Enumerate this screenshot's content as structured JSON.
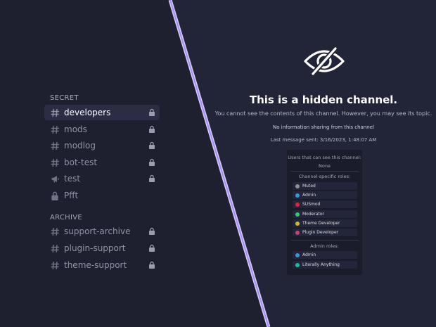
{
  "sidebar": {
    "categories": [
      {
        "name": "SECRET",
        "channels": [
          {
            "name": "developers",
            "icon": "text-channel-hash-icon",
            "locked": true,
            "selected": true
          },
          {
            "name": "mods",
            "icon": "text-channel-hash-icon",
            "locked": true
          },
          {
            "name": "modlog",
            "icon": "text-channel-hash-icon",
            "locked": true
          },
          {
            "name": "bot-test",
            "icon": "text-channel-hash-icon",
            "locked": true
          },
          {
            "name": "test",
            "icon": "announcement-megaphone-icon",
            "locked": true
          },
          {
            "name": "Pfft",
            "icon": "locked-voice-lock-icon",
            "locked": false
          }
        ]
      },
      {
        "name": "ARCHIVE",
        "channels": [
          {
            "name": "support-archive",
            "icon": "text-channel-hash-icon",
            "locked": true
          },
          {
            "name": "plugin-support",
            "icon": "text-channel-hash-icon",
            "locked": true
          },
          {
            "name": "theme-support",
            "icon": "text-channel-hash-icon",
            "locked": true
          }
        ]
      }
    ]
  },
  "hidden": {
    "icon": "eye-slash-icon",
    "title": "This is a hidden channel.",
    "subtitle": "You cannot see the contents of this channel. However, you may see its topic.",
    "topic": "No information sharing from this channel",
    "last_message": "Last message sent: 3/16/2023, 1:48:07 AM",
    "users_header": "Users that can see this channel:",
    "users_value": "None",
    "channel_roles_header": "Channel-specific roles:",
    "channel_roles": [
      {
        "name": "Muted",
        "color": "#8e9297"
      },
      {
        "name": "Admin",
        "color": "#3498db"
      },
      {
        "name": "SUSmod",
        "color": "#e91e3c"
      },
      {
        "name": "Moderator",
        "color": "#2ecc71"
      },
      {
        "name": "Theme Developer",
        "color": "#d4b62a"
      },
      {
        "name": "Plugin Developer",
        "color": "#c0447c"
      }
    ],
    "admin_roles_header": "Admin roles:",
    "admin_roles": [
      {
        "name": "Admin",
        "color": "#3498db"
      },
      {
        "name": "Literally Anything",
        "color": "#1abc9c"
      }
    ]
  },
  "colors": {
    "divider": "#b8a6ff",
    "background": "#1e2030"
  }
}
